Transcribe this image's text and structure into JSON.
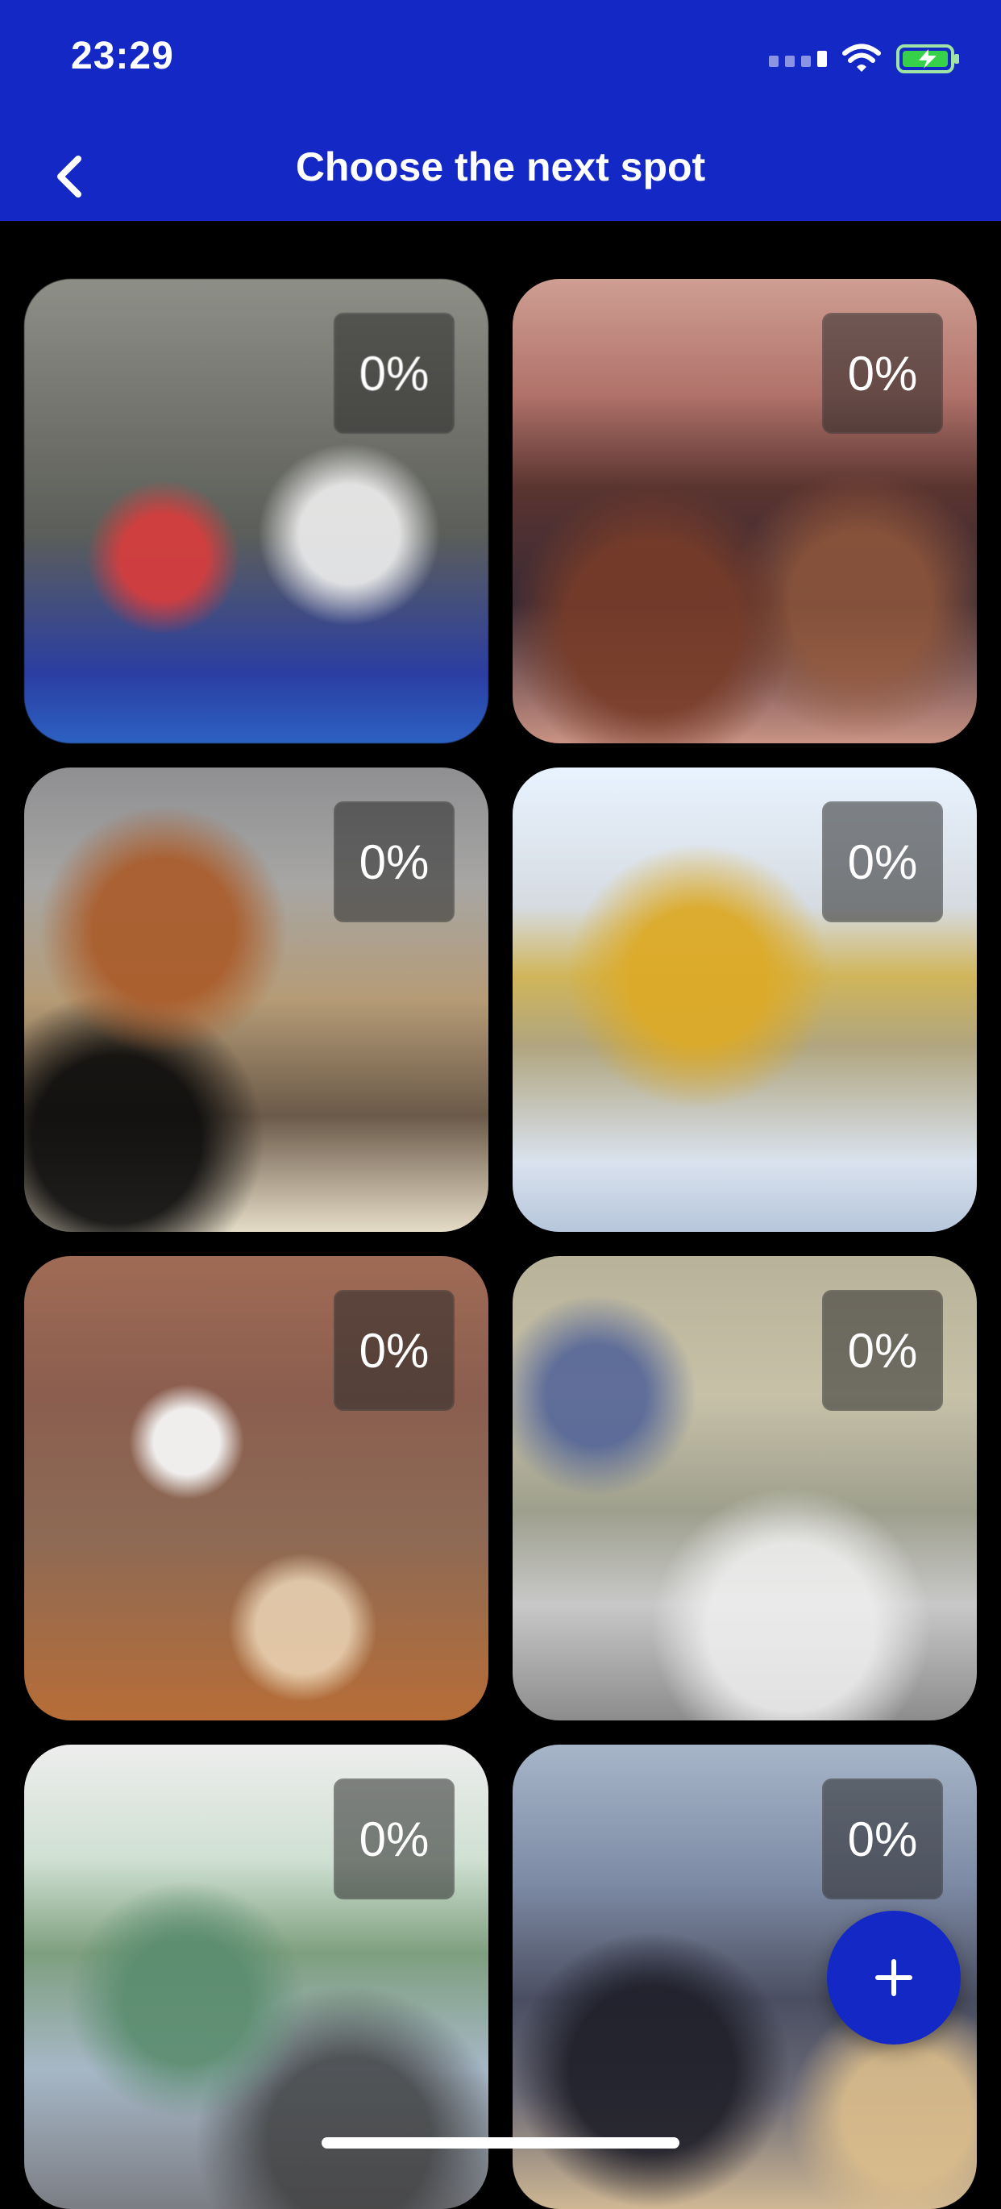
{
  "status_bar": {
    "time": "23:29"
  },
  "header": {
    "title": "Choose the next spot"
  },
  "grid": {
    "tiles": [
      {
        "progress": "0%"
      },
      {
        "progress": "0%"
      },
      {
        "progress": "0%"
      },
      {
        "progress": "0%"
      },
      {
        "progress": "0%"
      },
      {
        "progress": "0%"
      },
      {
        "progress": "0%"
      },
      {
        "progress": "0%"
      }
    ]
  },
  "icons": {
    "back": "chevron-left-icon",
    "fab": "plus-icon",
    "wifi": "wifi-icon",
    "battery": "battery-charging-icon",
    "signal": "cellular-signal-icon"
  },
  "colors": {
    "brand_blue": "#1428C6",
    "background": "#000000"
  }
}
